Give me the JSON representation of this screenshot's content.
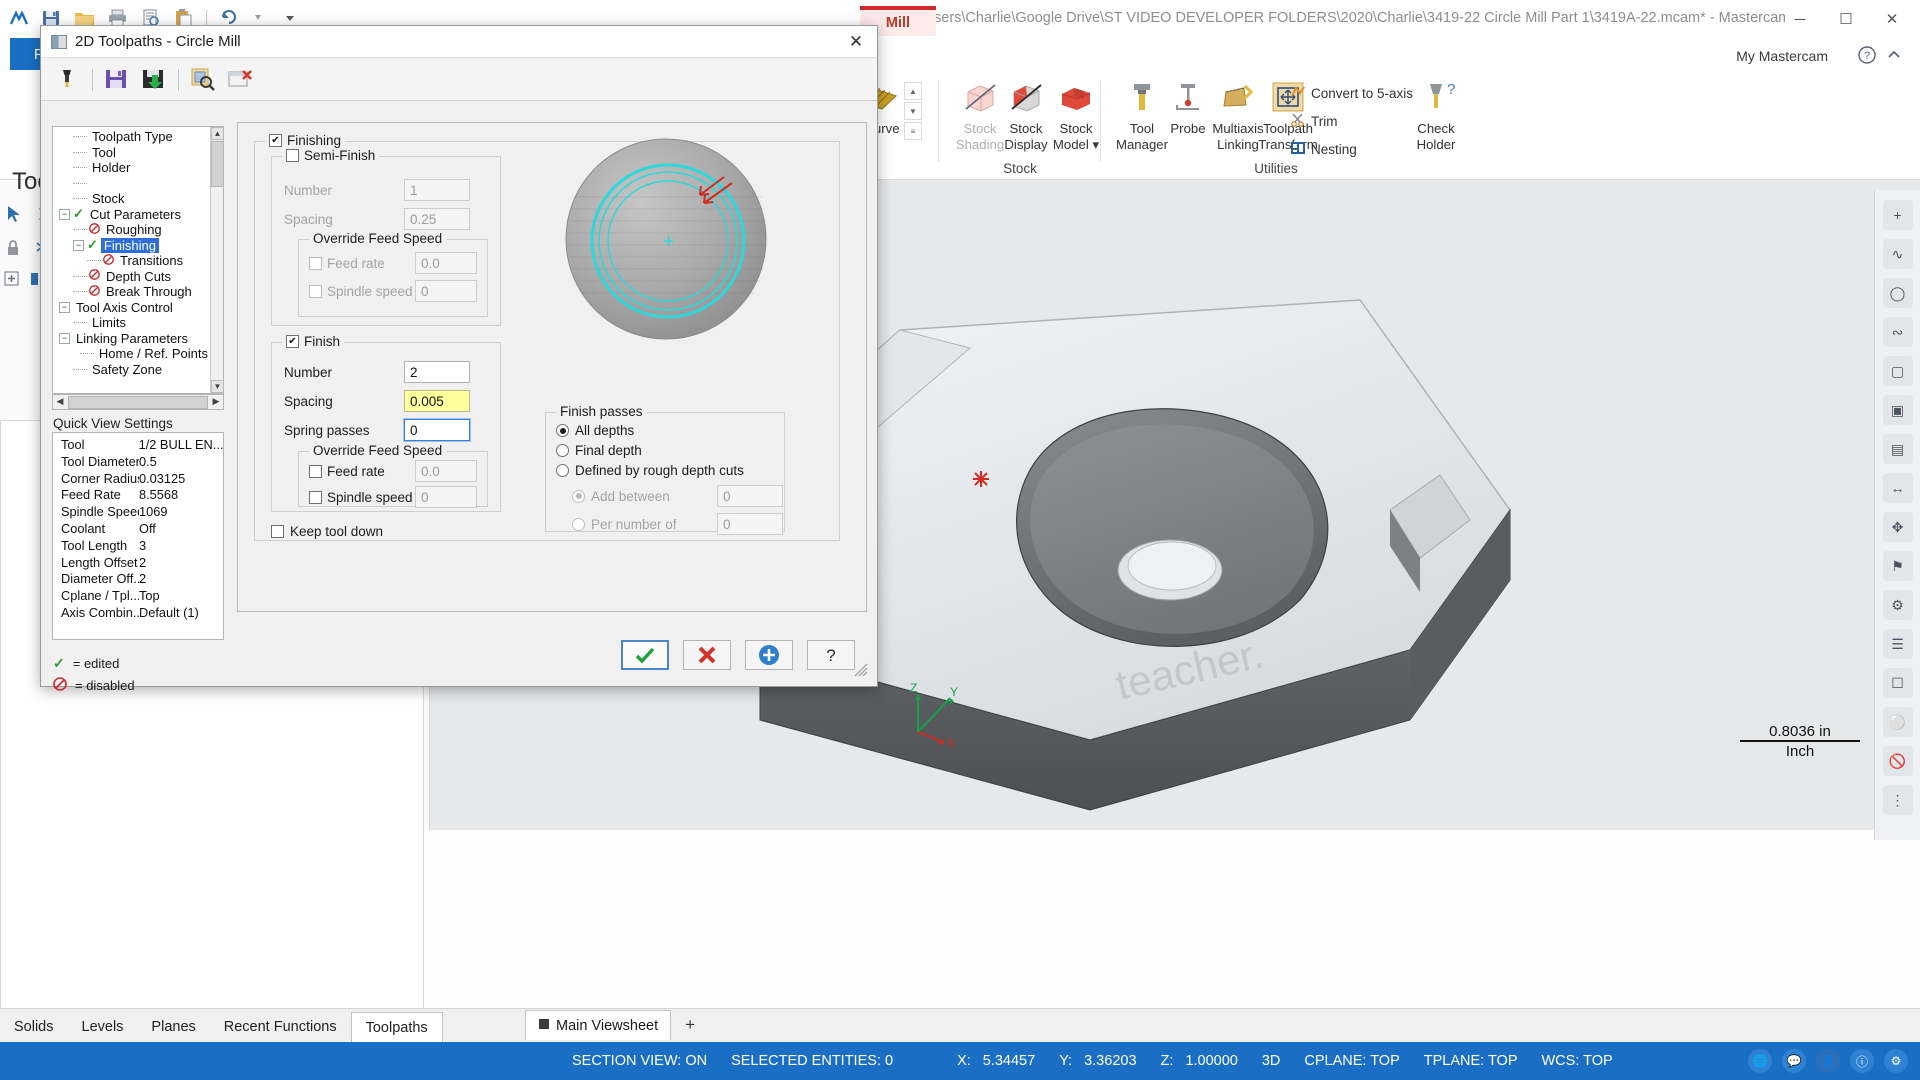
{
  "app": {
    "window_title": "C:\\Users\\Charlie\\Google Drive\\ST VIDEO DEVELOPER FOLDERS\\2020\\Charlie\\3419-22 Circle Mill Part 1\\3419A-22.mcam* - Mastercam M...",
    "file_tab": "File",
    "mill_tab": "Mill",
    "my_mastercam": "My Mastercam",
    "window_controls": {
      "minimize": "─",
      "maximize": "☐",
      "close": "✕"
    },
    "quick_access": [
      "mastercam-logo-icon",
      "save-icon",
      "open-folder-icon",
      "print-icon",
      "print-preview-icon",
      "paste-icon",
      "undo-icon",
      "redo-icon",
      "customize-qat-icon"
    ],
    "header_icons": [
      "help-icon",
      "collapse-ribbon-icon"
    ]
  },
  "ribbon": {
    "groups": [
      {
        "name": "Stock",
        "label": "Stock",
        "buttons": [
          {
            "label_line1": "Stock",
            "label_line2": "Shading",
            "icon": "stock-shading-icon",
            "disabled": true
          },
          {
            "label_line1": "Stock",
            "label_line2": "Display",
            "icon": "stock-display-icon",
            "disabled": false
          },
          {
            "label_line1": "Stock",
            "label_line2": "Model ▾",
            "icon": "stock-model-icon",
            "disabled": false
          }
        ]
      },
      {
        "name": "Utilities",
        "label": "Utilities",
        "buttons": [
          {
            "label_line1": "Tool",
            "label_line2": "Manager",
            "icon": "tool-manager-icon"
          },
          {
            "label_line1": "Probe",
            "label_line2": "",
            "icon": "probe-icon"
          },
          {
            "label_line1": "Multiaxis",
            "label_line2": "Linking",
            "icon": "multiaxis-linking-icon"
          },
          {
            "label_line1": "Toolpath",
            "label_line2": "Transform",
            "icon": "toolpath-transform-icon"
          },
          {
            "label_line1": "Check",
            "label_line2": "Holder",
            "icon": "check-holder-icon"
          }
        ],
        "small_buttons": [
          {
            "label": "Convert to 5-axis",
            "icon": "convert-5axis-icon"
          },
          {
            "label": "Trim",
            "icon": "trim-icon"
          },
          {
            "label": "Nesting",
            "icon": "nesting-icon"
          }
        ]
      },
      {
        "name": "Curve",
        "label": "",
        "buttons": [
          {
            "label_line1": "Curve",
            "label_line2": "",
            "icon": "curve-icon"
          }
        ]
      }
    ]
  },
  "left_panel": {
    "title": "Tool",
    "tabs": [
      "Solids",
      "Levels",
      "Planes",
      "Recent Functions",
      "Toolpaths"
    ],
    "active_tab": "Toolpaths"
  },
  "viewsheet": {
    "tab_label": "Main Viewsheet",
    "add_label": "+"
  },
  "statusbar": {
    "section_view": "SECTION VIEW: ON",
    "selected_entities": "SELECTED ENTITIES: 0",
    "x_label": "X:",
    "x_value": "5.34457",
    "y_label": "Y:",
    "y_value": "3.36203",
    "z_label": "Z:",
    "z_value": "1.00000",
    "mode": "3D",
    "cplane": "CPLANE: TOP",
    "tplane": "TPLANE: TOP",
    "wcs": "WCS: TOP"
  },
  "scale_bar": {
    "value": "0.8036 in",
    "unit": "Inch"
  },
  "gizmo": {
    "z": "Z",
    "y": "Y",
    "x": "X"
  },
  "dialog": {
    "title": "2D Toolpaths - Circle Mill",
    "close_label": "✕",
    "toolbar_icons": [
      "tool-settings-icon",
      "save-parameters-icon",
      "import-parameters-icon",
      "preview-toolpath-icon",
      "clear-parameters-icon"
    ],
    "tree": {
      "nodes": [
        {
          "label": "Toolpath Type",
          "indent": 1,
          "mark": "none",
          "expander": "none",
          "selected": false
        },
        {
          "label": "Tool",
          "indent": 1,
          "mark": "none",
          "expander": "none",
          "selected": false
        },
        {
          "label": "Holder",
          "indent": 1,
          "mark": "none",
          "expander": "none",
          "selected": false
        },
        {
          "label": "",
          "indent": 1,
          "mark": "none",
          "expander": "none",
          "selected": false
        },
        {
          "label": "Stock",
          "indent": 1,
          "mark": "none",
          "expander": "none",
          "selected": false
        },
        {
          "label": "Cut Parameters",
          "indent": 0,
          "mark": "edited",
          "expander": "minus",
          "selected": false
        },
        {
          "label": "Roughing",
          "indent": 1,
          "mark": "disabled",
          "expander": "none",
          "selected": false
        },
        {
          "label": "Finishing",
          "indent": 1,
          "mark": "edited",
          "expander": "minus",
          "selected": true
        },
        {
          "label": "Transitions",
          "indent": 2,
          "mark": "disabled",
          "expander": "none",
          "selected": false
        },
        {
          "label": "Depth Cuts",
          "indent": 1,
          "mark": "disabled",
          "expander": "none",
          "selected": false
        },
        {
          "label": "Break Through",
          "indent": 1,
          "mark": "disabled",
          "expander": "none",
          "selected": false
        },
        {
          "label": "Tool Axis Control",
          "indent": 0,
          "mark": "none",
          "expander": "minus",
          "selected": false
        },
        {
          "label": "Limits",
          "indent": 1,
          "mark": "none",
          "expander": "none",
          "selected": false
        },
        {
          "label": "Linking Parameters",
          "indent": 0,
          "mark": "none",
          "expander": "minus",
          "selected": false
        },
        {
          "label": "Home / Ref. Points",
          "indent": 2,
          "mark": "none",
          "expander": "none",
          "selected": false
        },
        {
          "label": "Safety Zone",
          "indent": 1,
          "mark": "none",
          "expander": "none",
          "selected": false
        }
      ]
    },
    "quick_view": {
      "heading": "Quick View Settings",
      "rows": [
        {
          "key": "Tool",
          "value": "1/2 BULL EN..."
        },
        {
          "key": "Tool Diameter",
          "value": "0.5"
        },
        {
          "key": "Corner Radius",
          "value": "0.03125"
        },
        {
          "key": "Feed Rate",
          "value": "8.5568"
        },
        {
          "key": "Spindle Speed",
          "value": "1069"
        },
        {
          "key": "Coolant",
          "value": "Off"
        },
        {
          "key": "Tool Length",
          "value": "3"
        },
        {
          "key": "Length Offset",
          "value": "2"
        },
        {
          "key": "Diameter Off...",
          "value": "2"
        },
        {
          "key": "Cplane / Tpl...",
          "value": "Top"
        },
        {
          "key": "Axis Combin...",
          "value": "Default (1)"
        }
      ]
    },
    "legend": [
      {
        "icon": "check-icon",
        "text": "= edited"
      },
      {
        "icon": "disabled-icon",
        "text": "= disabled"
      }
    ],
    "finishing": {
      "group_label": "Finishing",
      "checked": true,
      "semi_finish": {
        "group_label": "Semi-Finish",
        "checked": false,
        "number_label": "Number",
        "number_value": "1",
        "spacing_label": "Spacing",
        "spacing_value": "0.25",
        "override": {
          "group_label": "Override Feed Speed",
          "feed_rate_label": "Feed rate",
          "feed_rate_checked": false,
          "feed_rate_value": "0.0",
          "spindle_speed_label": "Spindle speed",
          "spindle_speed_checked": false,
          "spindle_speed_value": "0"
        }
      },
      "finish": {
        "group_label": "Finish",
        "checked": true,
        "number_label": "Number",
        "number_value": "2",
        "spacing_label": "Spacing",
        "spacing_value": "0.005",
        "spring_passes_label": "Spring passes",
        "spring_passes_value": "0",
        "override": {
          "group_label": "Override Feed Speed",
          "feed_rate_label": "Feed rate",
          "feed_rate_checked": false,
          "feed_rate_value": "0.0",
          "spindle_speed_label": "Spindle speed",
          "spindle_speed_checked": false,
          "spindle_speed_value": "0"
        }
      },
      "keep_tool_down_label": "Keep tool down",
      "keep_tool_down_checked": false,
      "finish_passes": {
        "group_label": "Finish passes",
        "options": [
          {
            "label": "All depths",
            "selected": true,
            "disabled": false
          },
          {
            "label": "Final depth",
            "selected": false,
            "disabled": false
          },
          {
            "label": "Defined by rough depth cuts",
            "selected": false,
            "disabled": false
          }
        ],
        "sub_options": [
          {
            "label": "Add between",
            "selected": true,
            "disabled": true,
            "value": "0"
          },
          {
            "label": "Per number of",
            "selected": false,
            "disabled": true,
            "value": "0"
          }
        ]
      }
    },
    "buttons": [
      {
        "name": "ok-button",
        "icon": "check-icon",
        "color": "#1f9f3d"
      },
      {
        "name": "cancel-button",
        "icon": "x-icon",
        "color": "#d2332a"
      },
      {
        "name": "apply-button",
        "icon": "plus-icon",
        "color": "#2e7ecb"
      },
      {
        "name": "help-button",
        "icon": "question-icon",
        "color": "#2b2b2b"
      }
    ]
  },
  "colors": {
    "accent": "#1a6fc4",
    "selection": "#2d6fd6",
    "toolpath_cyan": "#35e0e0",
    "highlight_yellow": "#ffff9e",
    "edited_green": "#2e9b2e",
    "disabled_red": "#cc2b2b",
    "mill_red": "#cf2a2a"
  }
}
